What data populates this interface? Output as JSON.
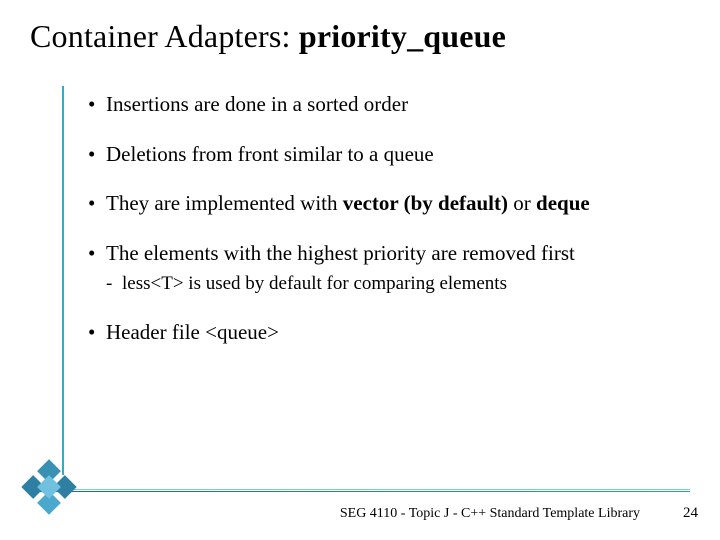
{
  "title": {
    "prefix": "Container Adapters: ",
    "bold": "priority_queue"
  },
  "bullets": [
    {
      "runs": [
        {
          "t": "Insertions are done in a sorted order"
        }
      ]
    },
    {
      "runs": [
        {
          "t": "Deletions from front similar to a queue"
        }
      ]
    },
    {
      "runs": [
        {
          "t": "They are implemented with "
        },
        {
          "t": "vector (by default)",
          "bold": true
        },
        {
          "t": " or "
        },
        {
          "t": "deque",
          "bold": true
        }
      ]
    },
    {
      "runs": [
        {
          "t": "The elements with the highest priority are removed first"
        }
      ],
      "sub": [
        {
          "runs": [
            {
              "t": "less<T> is used by default for comparing elements"
            }
          ]
        }
      ]
    },
    {
      "runs": [
        {
          "t": "Header file <queue>"
        }
      ]
    }
  ],
  "footer": "SEG 4110 - Topic J - C++ Standard Template Library",
  "page": "24"
}
